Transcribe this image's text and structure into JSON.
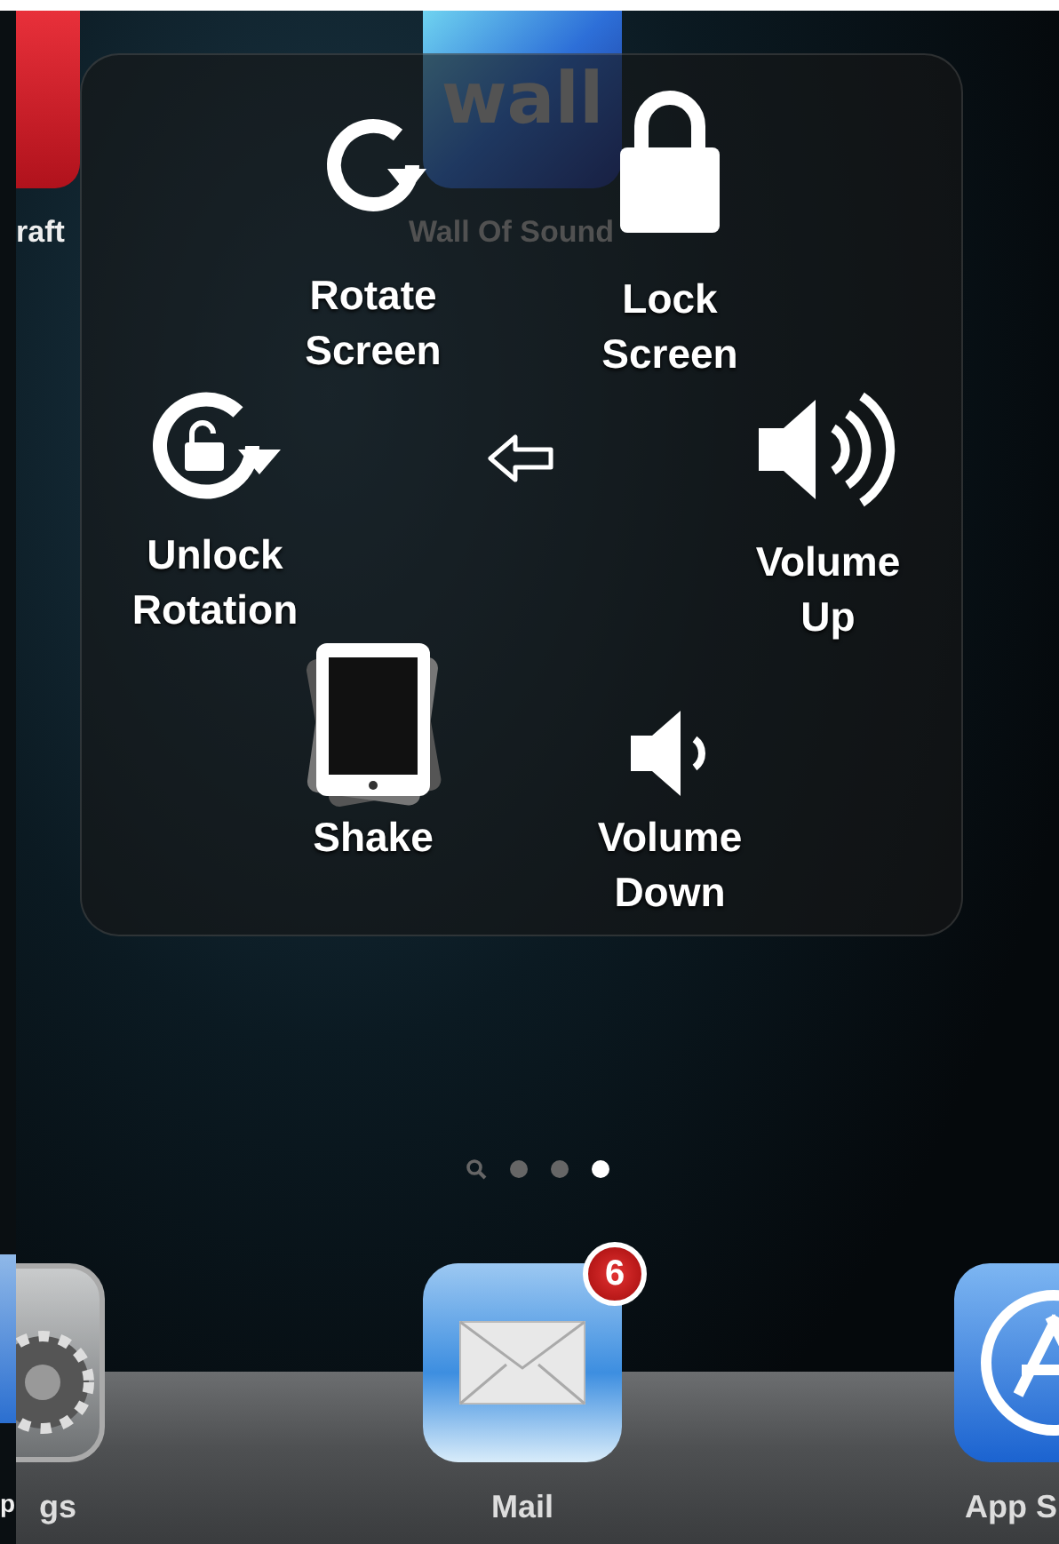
{
  "home_screen": {
    "apps": [
      {
        "label": "raft",
        "kind": "helmet"
      },
      {
        "label": "Wall Of Sound",
        "kind": "wall",
        "icon_text": "wall"
      }
    ],
    "page_dots": [
      {
        "kind": "search",
        "selected": false
      },
      {
        "kind": "dot",
        "selected": false
      },
      {
        "kind": "dot",
        "selected": false
      },
      {
        "kind": "dot",
        "selected": true
      }
    ]
  },
  "assistive_menu": {
    "rows": [
      [
        {
          "kind": "rotate",
          "label": "Rotate\nScreen"
        },
        {
          "kind": "lock",
          "label": "Lock\nScreen"
        }
      ],
      [
        {
          "kind": "unlock-rotation",
          "label": "Unlock\nRotation"
        },
        {
          "kind": "back"
        },
        {
          "kind": "volume-up",
          "label": "Volume\nUp"
        }
      ],
      [
        {
          "kind": "shake",
          "label": "Shake"
        },
        {
          "kind": "volume-down",
          "label": "Volume\nDown"
        }
      ]
    ]
  },
  "dock": {
    "edge_label": "p",
    "apps": [
      {
        "kind": "settings",
        "label": "gs"
      },
      {
        "kind": "mail",
        "label": "Mail",
        "badge": "6"
      },
      {
        "kind": "appstore",
        "label": "App S"
      }
    ]
  }
}
